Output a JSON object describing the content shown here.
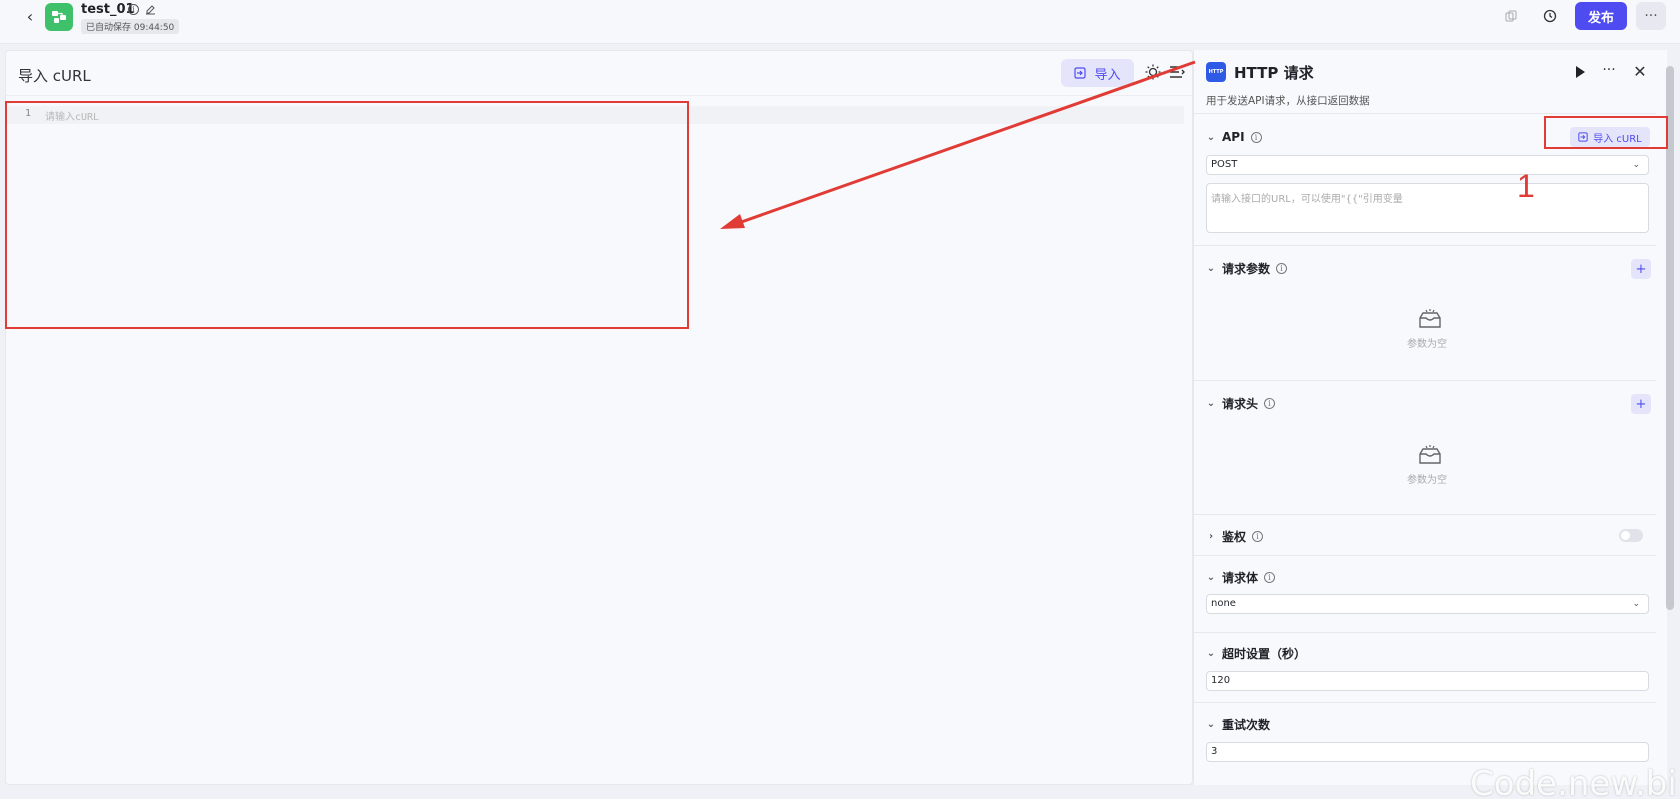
{
  "header": {
    "app_name": "test_01",
    "autosave": "已自动保存 09:44:50",
    "publish_label": "发布",
    "more_label": "···"
  },
  "editor": {
    "title": "导入 cURL",
    "import_label": "导入",
    "line_number": "1",
    "placeholder": "请输入cURL"
  },
  "node": {
    "logo_text": "HTTP",
    "title": "HTTP 请求",
    "description": "用于发送API请求，从接口返回数据",
    "api": {
      "label": "API",
      "import_curl_label": "导入 cURL",
      "method": "POST",
      "url_placeholder": "请输入接口的URL，可以使用\"{{\"引用变量"
    },
    "params": {
      "label": "请求参数",
      "empty_text": "参数为空"
    },
    "headers": {
      "label": "请求头",
      "empty_text": "参数为空"
    },
    "auth": {
      "label": "鉴权",
      "enabled": false
    },
    "body": {
      "label": "请求体",
      "type": "none"
    },
    "timeout": {
      "label": "超时设置（秒）",
      "value": "120"
    },
    "retry": {
      "label": "重试次数",
      "value": "3"
    }
  },
  "annotation": {
    "number": "1",
    "color": "#e13b36"
  },
  "watermark": "Code.new.bi",
  "colors": {
    "accent": "#4e4bf0",
    "logo_green": "#3ec16a",
    "http_blue": "#2f5ae6"
  }
}
